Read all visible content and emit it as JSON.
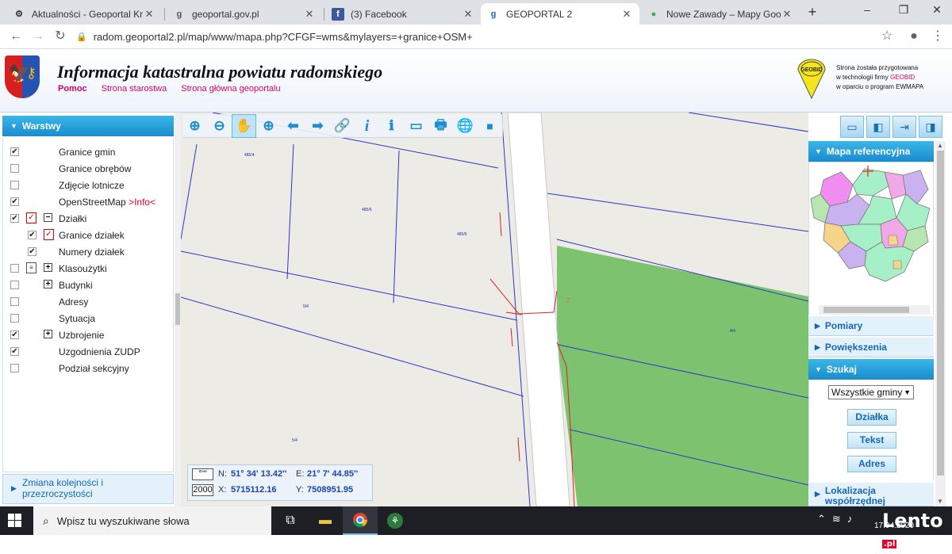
{
  "browser": {
    "tabs": [
      {
        "title": "Aktualności - Geoportal Krajo",
        "icon": "geoportal-gear-icon",
        "active": false
      },
      {
        "title": "geoportal.gov.pl",
        "icon": "g-letter-icon",
        "active": false
      },
      {
        "title": "(3) Facebook",
        "icon": "facebook-icon",
        "active": false
      },
      {
        "title": "GEOPORTAL 2",
        "icon": "g-letter-icon",
        "active": true
      },
      {
        "title": "Nowe Zawady – Mapy Google",
        "icon": "google-maps-pin-icon",
        "active": false
      }
    ],
    "new_tab": "+",
    "window_controls": {
      "minimize": "–",
      "maximize": "❐",
      "close": "✕"
    },
    "url": "radom.geoportal2.pl/map/www/mapa.php?CFGF=wms&mylayers=+granice+OSM+",
    "nav": {
      "back": "←",
      "forward": "→",
      "reload": "↻"
    }
  },
  "header": {
    "title": "Informacja katastralna powiatu radomskiego",
    "links": [
      {
        "label": "Pomoc",
        "bold": true
      },
      {
        "label": "Strona starostwa",
        "bold": false
      },
      {
        "label": "Strona główna geoportalu",
        "bold": false
      }
    ],
    "geobid_logo_text": "GEOBID",
    "geobid_lines": [
      "Strona została przygotowana",
      "w technologii firmy ",
      "GEOBID",
      "w oparciu o program EWMAPA"
    ]
  },
  "left_panel": {
    "title": "Warstwy",
    "layers": [
      {
        "label": "Granice gmin",
        "checked": true,
        "indent": 0
      },
      {
        "label": "Granice obrębów",
        "checked": false,
        "indent": 0
      },
      {
        "label": "Zdjęcie lotnicze",
        "checked": false,
        "indent": 0
      },
      {
        "label": "OpenStreetMap ",
        "info": ">Info<",
        "checked": true,
        "indent": 0
      },
      {
        "label": "Działki",
        "checked": true,
        "indent": 0,
        "legend": "red-check-icon",
        "expander": "−"
      },
      {
        "label": "Granice działek",
        "checked": true,
        "indent": 1,
        "legend": "red-check-icon"
      },
      {
        "label": "Numery działek",
        "checked": true,
        "indent": 1
      },
      {
        "label": "Klasoużytki",
        "checked": false,
        "indent": 0,
        "legend": "document-icon",
        "expander": "+"
      },
      {
        "label": "Budynki",
        "checked": false,
        "indent": 0,
        "expander": "+"
      },
      {
        "label": "Adresy",
        "checked": false,
        "indent": 0
      },
      {
        "label": "Sytuacja",
        "checked": false,
        "indent": 0
      },
      {
        "label": "Uzbrojenie",
        "checked": true,
        "indent": 0,
        "expander": "+"
      },
      {
        "label": "Uzgodnienia ZUDP",
        "checked": true,
        "indent": 0
      },
      {
        "label": "Podział sekcyjny",
        "checked": false,
        "indent": 0
      }
    ],
    "footer": "Zmiana kolejności i przezroczystości"
  },
  "map": {
    "tools": [
      {
        "name": "zoom-in-icon",
        "glyph": "⊕"
      },
      {
        "name": "zoom-out-icon",
        "glyph": "⊖"
      },
      {
        "name": "pan-hand-icon",
        "glyph": "✋"
      },
      {
        "name": "zoom-extent-icon",
        "glyph": "⊕"
      },
      {
        "name": "previous-view-arrow-icon",
        "glyph": "⬅"
      },
      {
        "name": "next-view-arrow-icon",
        "glyph": "➡"
      },
      {
        "name": "link-icon",
        "glyph": "🔗"
      },
      {
        "name": "info-icon",
        "glyph": "i"
      },
      {
        "name": "info-list-icon",
        "glyph": "ℹ"
      },
      {
        "name": "measure-ruler-icon",
        "glyph": "▭"
      },
      {
        "name": "print-icon",
        "glyph": "🖶"
      },
      {
        "name": "globe-icon",
        "glyph": "🌐"
      },
      {
        "name": "video-camera-icon",
        "glyph": "■"
      }
    ],
    "parcel_labels": [
      "485/4",
      "485/6",
      "485/6",
      "5/4",
      "5/4",
      "4/4"
    ],
    "coords": {
      "deg_box": "°'\"",
      "scale_box": "2000",
      "n_label": "N:",
      "n_value": "51° 34' 13.42''",
      "e_label": "E:",
      "e_value": "21° 7' 44.85''",
      "x_label": "X:",
      "x_value": "5715112.16",
      "y_label": "Y:",
      "y_value": "7508951.95"
    },
    "colors": {
      "background": "#ecebe6",
      "forest": "#7dc26e",
      "parcel_line": "#2f36c9",
      "road": "#ffffff",
      "utility": "#e02020"
    }
  },
  "right_panel": {
    "top_icons": [
      "layout-full-icon",
      "layout-left-icon",
      "export-arrow-icon",
      "layout-right-icon"
    ],
    "sections": {
      "ref_map": "Mapa referencyjna",
      "pomiary": "Pomiary",
      "powiekszenia": "Powiększenia",
      "szukaj": "Szukaj",
      "lokalizacja": "Lokalizacja współrzędnej"
    },
    "gmina_select": "Wszystkie gminy",
    "buttons": {
      "dzialka": "Działka",
      "tekst": "Tekst",
      "adres": "Adres"
    }
  },
  "taskbar": {
    "search_placeholder": "Wpisz tu wyszukiwane słowa",
    "date": "17.04.2020",
    "watermark": "Lento",
    "watermark_tld": ".pl"
  }
}
